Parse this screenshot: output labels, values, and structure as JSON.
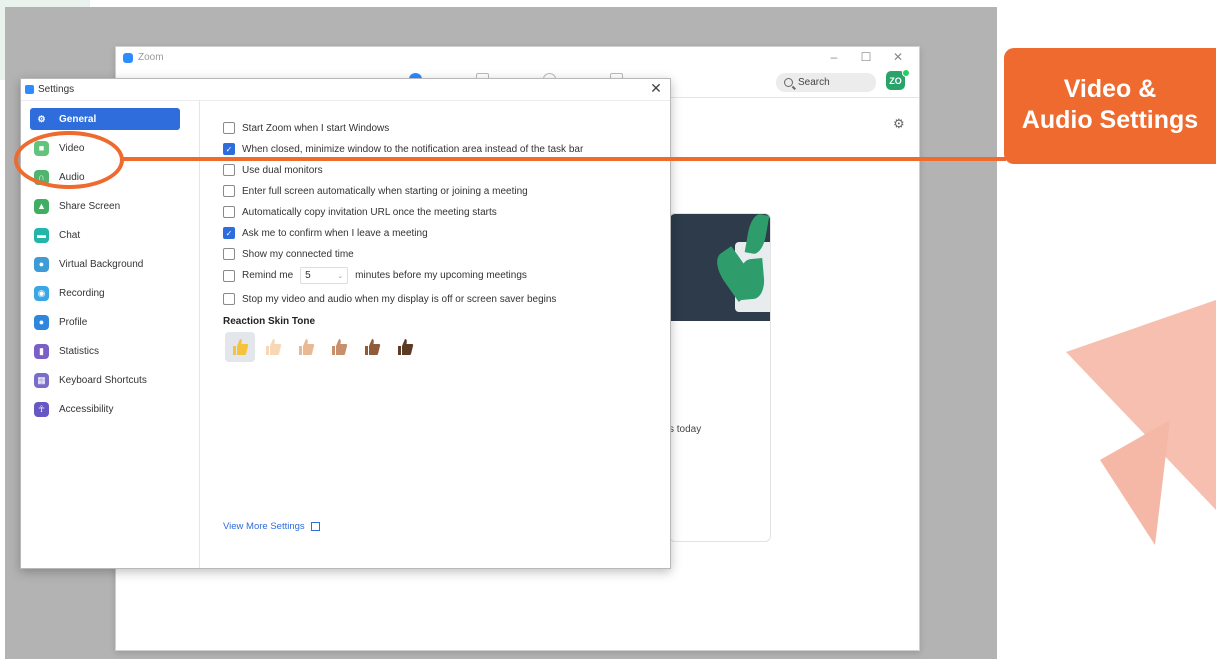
{
  "zoom_window": {
    "title": "Zoom",
    "search_label": "Search",
    "avatar_initials": "ZO",
    "card_text": "s today"
  },
  "settings": {
    "title": "Settings",
    "sidebar": [
      {
        "label": "General",
        "icon": "gear-icon",
        "color": "#2e6ddb",
        "active": true
      },
      {
        "label": "Video",
        "icon": "video-camera-icon",
        "color": "#62c37a"
      },
      {
        "label": "Audio",
        "icon": "headphones-icon",
        "color": "#4fb46e"
      },
      {
        "label": "Share Screen",
        "icon": "share-screen-icon",
        "color": "#3fae63"
      },
      {
        "label": "Chat",
        "icon": "chat-bubble-icon",
        "color": "#22b5a8"
      },
      {
        "label": "Virtual Background",
        "icon": "person-background-icon",
        "color": "#3d9bd6"
      },
      {
        "label": "Recording",
        "icon": "record-icon",
        "color": "#39a6e6"
      },
      {
        "label": "Profile",
        "icon": "profile-icon",
        "color": "#2f86dd"
      },
      {
        "label": "Statistics",
        "icon": "bar-chart-icon",
        "color": "#7b5fc7"
      },
      {
        "label": "Keyboard Shortcuts",
        "icon": "keyboard-icon",
        "color": "#7a6dc9"
      },
      {
        "label": "Accessibility",
        "icon": "accessibility-icon",
        "color": "#6557c4"
      }
    ],
    "options": [
      {
        "label": "Start Zoom when I start Windows",
        "checked": false
      },
      {
        "label": "When closed, minimize window to the notification area instead of the task bar",
        "checked": true
      },
      {
        "label": "Use dual monitors",
        "checked": false
      },
      {
        "label": "Enter full screen automatically when starting or joining a meeting",
        "checked": false
      },
      {
        "label": "Automatically copy invitation URL once the meeting starts",
        "checked": false
      },
      {
        "label": "Ask me to confirm when I leave a meeting",
        "checked": true
      },
      {
        "label": "Show my connected time",
        "checked": false
      }
    ],
    "remind": {
      "before": "Remind me",
      "value": "5",
      "after": "minutes before my upcoming meetings",
      "checked": false
    },
    "stop_video_option": {
      "label": "Stop my video and audio when my display is off or screen saver begins",
      "checked": false
    },
    "reaction_title": "Reaction Skin Tone",
    "skin_tones": [
      "#f5c33b",
      "#f7d7b5",
      "#e9b994",
      "#c8906a",
      "#8f5b3b",
      "#5c3a24"
    ],
    "view_more": "View More Settings"
  },
  "callout": {
    "line1": "Video &",
    "line2": "Audio Settings",
    "color": "#ee6a2e"
  }
}
